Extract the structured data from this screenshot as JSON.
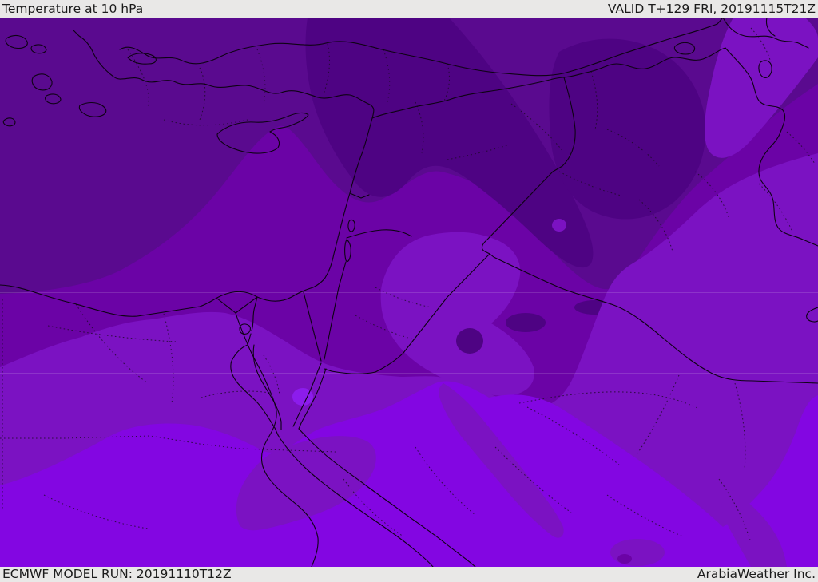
{
  "header": {
    "title": "Temperature at 10 hPa",
    "valid_label": "VALID T+129 FRI, 20191115T21Z"
  },
  "footer": {
    "model_run": "ECMWF MODEL RUN: 20191110T12Z",
    "brand": "ArabiaWeather Inc."
  },
  "map": {
    "colors": {
      "bar_background": "#e9e8e7",
      "bar_text": "#1b1b1b",
      "border_line": "#0e0214",
      "admin_line": "#1a0b22"
    },
    "levels": [
      {
        "name": "coldest-band",
        "color": "#4e0383"
      },
      {
        "name": "very-cold",
        "color": "#5a0a8f"
      },
      {
        "name": "cold-base",
        "color": "#6b03a6"
      },
      {
        "name": "mild",
        "color": "#7b12c2"
      },
      {
        "name": "warm",
        "color": "#8306e2"
      },
      {
        "name": "warmest-spot",
        "color": "#8c1cec"
      }
    ]
  }
}
